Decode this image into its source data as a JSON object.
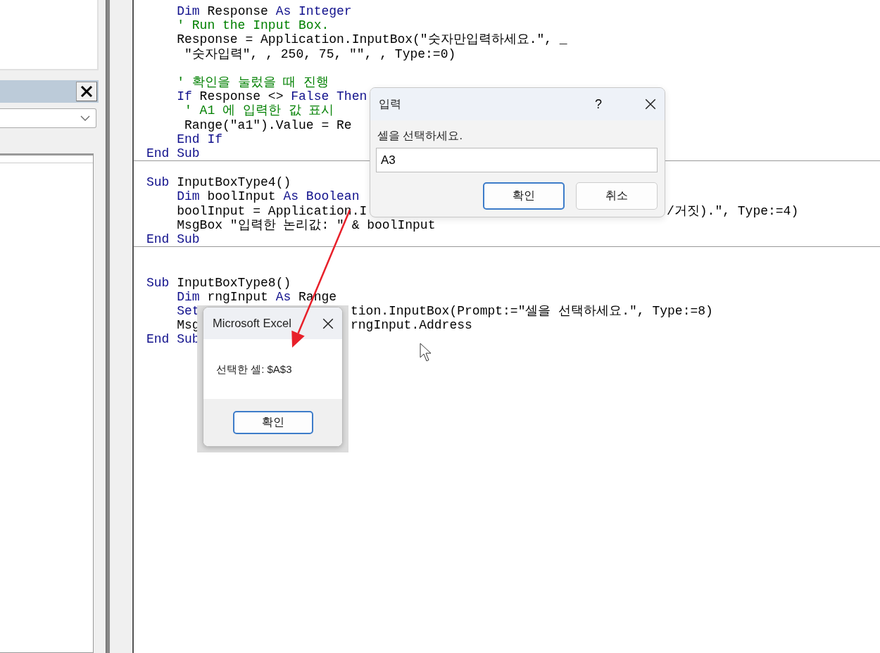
{
  "code_editor": {
    "procedures": [
      {
        "lines": [
          {
            "kind": "code",
            "segments": [
              {
                "kind": "keyword",
                "text": "    Dim"
              },
              {
                "kind": "plain",
                "text": " Response "
              },
              {
                "kind": "keyword",
                "text": "As Integer"
              }
            ]
          },
          {
            "kind": "code",
            "segments": [
              {
                "kind": "comment",
                "text": "    ' Run the Input Box."
              }
            ]
          },
          {
            "kind": "code",
            "segments": [
              {
                "kind": "plain",
                "text": "    Response = Application.InputBox(\"숫자만입력하세요.\", _"
              }
            ]
          },
          {
            "kind": "code",
            "segments": [
              {
                "kind": "plain",
                "text": "     \"숫자입력\", , 250, 75, \"\", , Type:=0)"
              }
            ]
          },
          {
            "kind": "blank"
          },
          {
            "kind": "code",
            "segments": [
              {
                "kind": "comment",
                "text": "    ' 확인을 눌렀을 때 진행"
              }
            ]
          },
          {
            "kind": "code",
            "segments": [
              {
                "kind": "keyword",
                "text": "    If"
              },
              {
                "kind": "plain",
                "text": " Response <> "
              },
              {
                "kind": "keyword",
                "text": "False Then"
              }
            ]
          },
          {
            "kind": "code",
            "segments": [
              {
                "kind": "comment",
                "text": "     ' A1 에 입력한 값 표시"
              }
            ]
          },
          {
            "kind": "code",
            "segments": [
              {
                "kind": "plain",
                "text": "     Range(\"a1\").Value = Re"
              }
            ]
          },
          {
            "kind": "code",
            "segments": [
              {
                "kind": "keyword",
                "text": "    End If"
              }
            ]
          },
          {
            "kind": "code",
            "segments": [
              {
                "kind": "keyword",
                "text": "End Sub"
              }
            ]
          }
        ]
      },
      {
        "lines": [
          {
            "kind": "blank"
          },
          {
            "kind": "code",
            "segments": [
              {
                "kind": "keyword",
                "text": "Sub"
              },
              {
                "kind": "plain",
                "text": " InputBoxType4()"
              }
            ]
          },
          {
            "kind": "code",
            "segments": [
              {
                "kind": "keyword",
                "text": "    Dim"
              },
              {
                "kind": "plain",
                "text": " boolInput "
              },
              {
                "kind": "keyword",
                "text": "As Boolean"
              }
            ]
          },
          {
            "kind": "code",
            "segments": [
              {
                "kind": "plain",
                "text": "    boolInput = Application.I"
              }
            ],
            "tail": {
              "text": "/거짓).\", Type:=4)"
            }
          },
          {
            "kind": "code",
            "segments": [
              {
                "kind": "plain",
                "text": "    MsgBox \"입력한 논리값: \" & boolInput"
              }
            ]
          },
          {
            "kind": "code",
            "segments": [
              {
                "kind": "keyword",
                "text": "End Sub"
              }
            ]
          }
        ]
      },
      {
        "lines": [
          {
            "kind": "blank"
          },
          {
            "kind": "blank"
          },
          {
            "kind": "code",
            "segments": [
              {
                "kind": "keyword",
                "text": "Sub"
              },
              {
                "kind": "plain",
                "text": " InputBoxType8()"
              }
            ]
          },
          {
            "kind": "code",
            "segments": [
              {
                "kind": "keyword",
                "text": "    Dim"
              },
              {
                "kind": "plain",
                "text": " rngInput "
              },
              {
                "kind": "keyword",
                "text": "As"
              },
              {
                "kind": "plain",
                "text": " Range"
              }
            ]
          },
          {
            "kind": "code",
            "segments": [
              {
                "kind": "keyword",
                "text": "    Set"
              }
            ],
            "tail": {
              "text": "tion.InputBox(Prompt:=\"셀을 선택하세요.\", Type:=8)"
            }
          },
          {
            "kind": "code",
            "segments": [
              {
                "kind": "plain",
                "text": "    Msg"
              }
            ],
            "tail": {
              "text": "rngInput.Address"
            }
          },
          {
            "kind": "code",
            "segments": [
              {
                "kind": "keyword",
                "text": "End Sub"
              }
            ]
          }
        ]
      }
    ]
  },
  "input_dialog": {
    "title": "입력",
    "help": "?",
    "prompt": "셀을 선택하세요.",
    "value": "A3",
    "buttons": [
      {
        "label": "확인",
        "default": true
      },
      {
        "label": "취소",
        "default": false
      }
    ]
  },
  "message_box": {
    "title": "Microsoft Excel",
    "message": "선택한 셀: $A$3",
    "buttons": [
      {
        "label": "확인",
        "default": true
      }
    ]
  }
}
